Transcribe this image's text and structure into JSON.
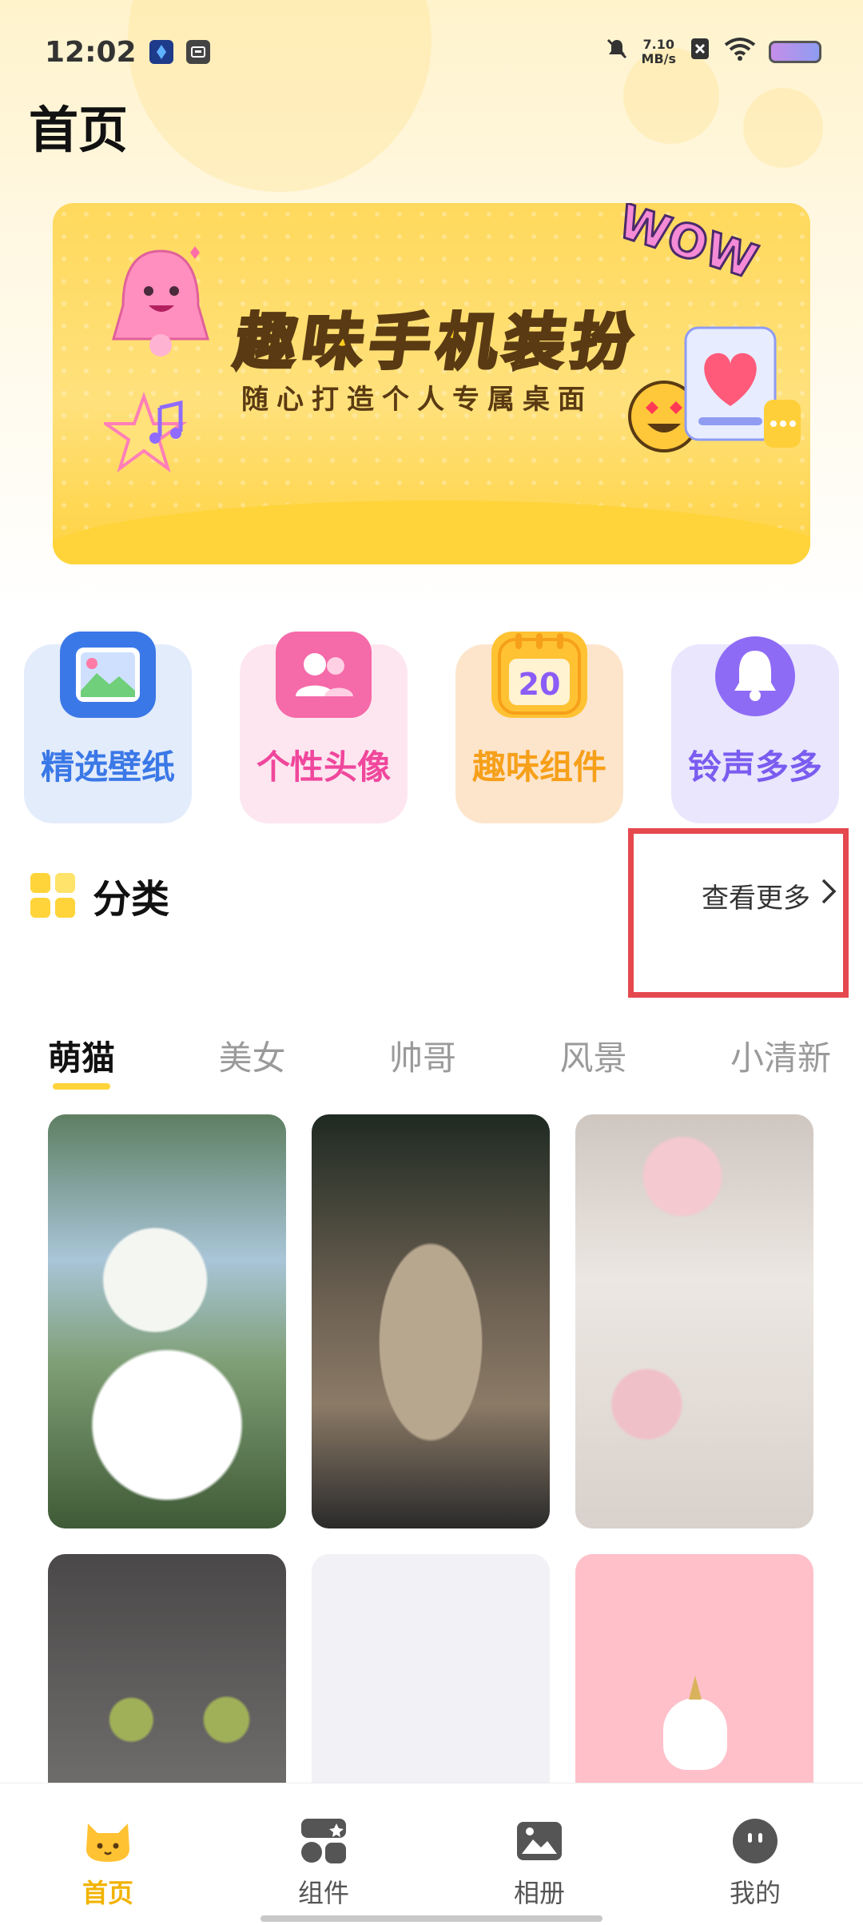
{
  "status_bar": {
    "time": "12:02",
    "net_speed_value": "7.10",
    "net_speed_unit": "MB/s",
    "icons": [
      "app-notification-icon",
      "app-notification-icon-2",
      "mute-icon",
      "sim-off-icon",
      "wifi-icon",
      "battery-icon"
    ]
  },
  "page_title": "首页",
  "banner": {
    "title": "趣味手机装扮",
    "subtitle": "随心打造个人专属桌面",
    "badge": "WOW"
  },
  "quick_entries": [
    {
      "label": "精选壁纸",
      "icon": "wallpaper-icon",
      "color": "#3b78e7",
      "bg": "#e3ecfb",
      "icon_bg": "#3b78e7"
    },
    {
      "label": "个性头像",
      "icon": "avatar-icon",
      "color": "#f0479c",
      "bg": "#fde6f0",
      "icon_bg": "#f56aa9"
    },
    {
      "label": "趣味组件",
      "icon": "calendar-icon",
      "color": "#f6a01a",
      "bg": "#fde5cc",
      "icon_bg": "#ffc233",
      "icon_text": "20"
    },
    {
      "label": "铃声多多",
      "icon": "bell-icon",
      "color": "#7a5cf0",
      "bg": "#e9e6fd",
      "icon_bg": "#8e6bf5"
    }
  ],
  "section": {
    "title": "分类",
    "see_more": "查看更多"
  },
  "tabs": [
    {
      "label": "萌猫",
      "active": true
    },
    {
      "label": "美女",
      "active": false
    },
    {
      "label": "帅哥",
      "active": false
    },
    {
      "label": "风景",
      "active": false
    },
    {
      "label": "小清新",
      "active": false
    }
  ],
  "bottom_nav": [
    {
      "label": "首页",
      "icon": "cat-icon",
      "active": true
    },
    {
      "label": "组件",
      "icon": "widgets-icon",
      "active": false
    },
    {
      "label": "相册",
      "icon": "image-icon",
      "active": false
    },
    {
      "label": "我的",
      "icon": "profile-icon",
      "active": false
    }
  ],
  "colors": {
    "accent": "#ffd43a",
    "highlight": "#e5484d"
  }
}
